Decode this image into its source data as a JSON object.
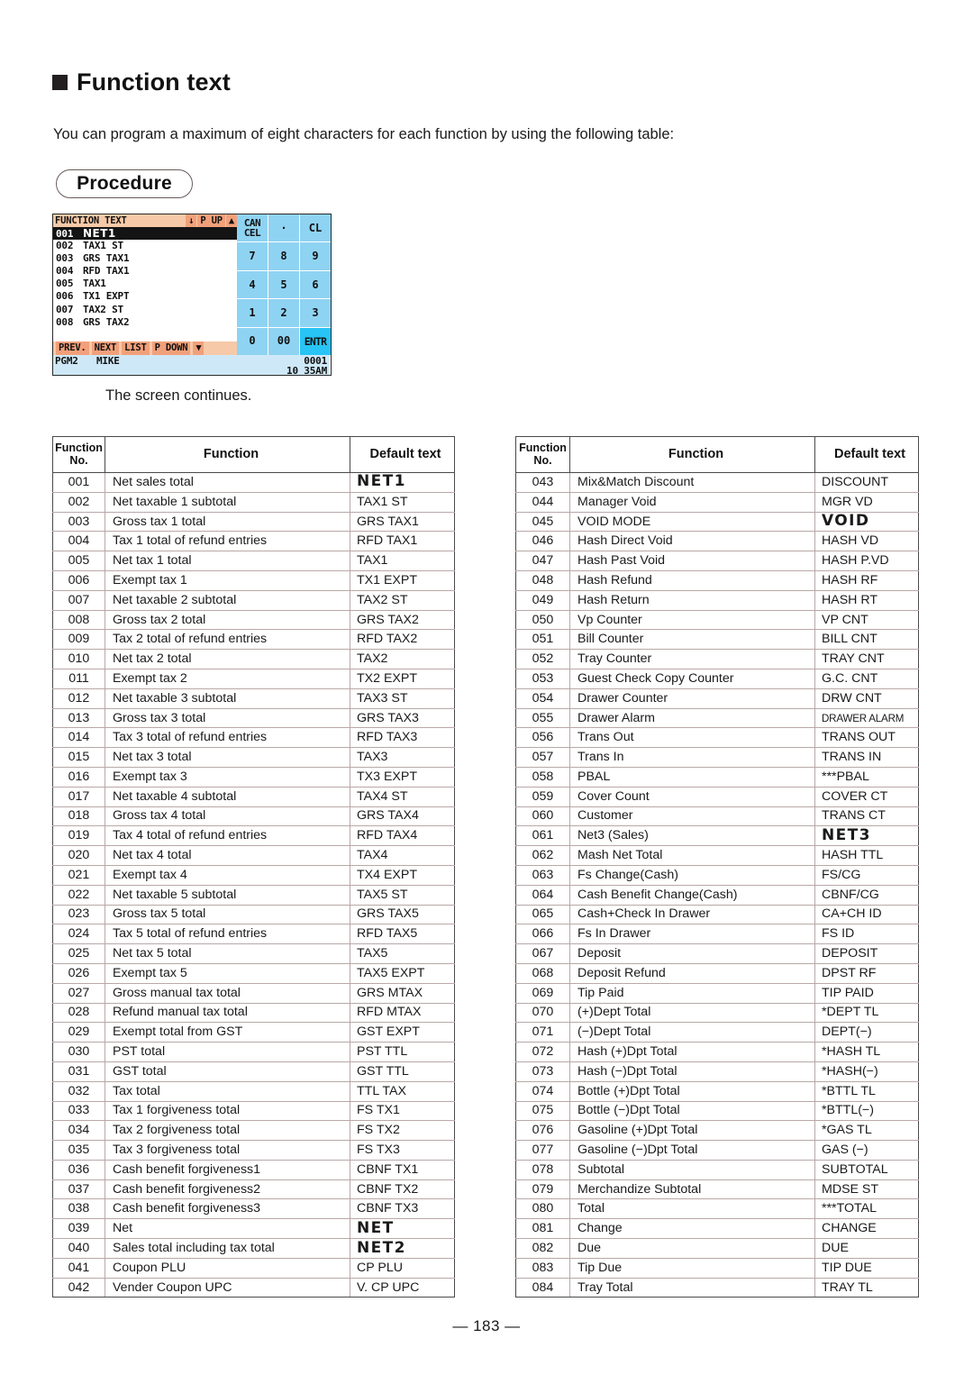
{
  "heading": {
    "title": "Function text"
  },
  "intro": {
    "text": "You can program a maximum of eight characters for each function by using the following table:"
  },
  "procedure": {
    "label": "Procedure"
  },
  "lcd": {
    "title": "FUNCTION TEXT",
    "title_buttons": [
      "↓",
      "P UP",
      "▲"
    ],
    "list": [
      {
        "no": "001",
        "text": "NET1",
        "selected": true
      },
      {
        "no": "002",
        "text": "TAX1 ST",
        "selected": false
      },
      {
        "no": "003",
        "text": "GRS TAX1",
        "selected": false
      },
      {
        "no": "004",
        "text": "RFD TAX1",
        "selected": false
      },
      {
        "no": "005",
        "text": "TAX1",
        "selected": false
      },
      {
        "no": "006",
        "text": "TX1 EXPT",
        "selected": false
      },
      {
        "no": "007",
        "text": "TAX2 ST",
        "selected": false
      },
      {
        "no": "008",
        "text": "GRS TAX2",
        "selected": false
      }
    ],
    "soft_buttons": [
      "PREV.",
      "NEXT",
      "LIST",
      "P DOWN",
      "▼"
    ],
    "keypad": [
      "CANCEL",
      "·",
      "CL",
      "7",
      "8",
      "9",
      "4",
      "5",
      "6",
      "1",
      "2",
      "3",
      "0",
      "00",
      "ENTR"
    ],
    "status": {
      "mode": "PGM2",
      "user": "MIKE",
      "counter": "0001",
      "clock": "10 35AM"
    }
  },
  "caption": {
    "screen_continues": "The screen continues."
  },
  "table_headers": {
    "no": "Function\nNo.",
    "no_line1": "Function",
    "no_line2": "No.",
    "function": "Function",
    "default_text": "Default text"
  },
  "left_table": [
    {
      "no": "001",
      "fn": "Net sales total",
      "txt": "NET1",
      "style": "lcd"
    },
    {
      "no": "002",
      "fn": "Net taxable 1 subtotal",
      "txt": "TAX1 ST",
      "style": ""
    },
    {
      "no": "003",
      "fn": "Gross tax 1 total",
      "txt": "GRS TAX1",
      "style": ""
    },
    {
      "no": "004",
      "fn": "Tax 1 total of refund entries",
      "txt": "RFD TAX1",
      "style": ""
    },
    {
      "no": "005",
      "fn": "Net tax 1 total",
      "txt": "TAX1",
      "style": ""
    },
    {
      "no": "006",
      "fn": "Exempt tax 1",
      "txt": "TX1 EXPT",
      "style": ""
    },
    {
      "no": "007",
      "fn": "Net taxable 2 subtotal",
      "txt": "TAX2 ST",
      "style": ""
    },
    {
      "no": "008",
      "fn": "Gross tax 2 total",
      "txt": "GRS TAX2",
      "style": ""
    },
    {
      "no": "009",
      "fn": "Tax 2 total of refund entries",
      "txt": "RFD TAX2",
      "style": ""
    },
    {
      "no": "010",
      "fn": "Net tax 2 total",
      "txt": "TAX2",
      "style": ""
    },
    {
      "no": "011",
      "fn": "Exempt tax 2",
      "txt": "TX2 EXPT",
      "style": ""
    },
    {
      "no": "012",
      "fn": "Net taxable 3 subtotal",
      "txt": "TAX3 ST",
      "style": ""
    },
    {
      "no": "013",
      "fn": "Gross tax 3 total",
      "txt": "GRS TAX3",
      "style": ""
    },
    {
      "no": "014",
      "fn": "Tax 3 total of refund entries",
      "txt": "RFD TAX3",
      "style": ""
    },
    {
      "no": "015",
      "fn": "Net tax 3 total",
      "txt": "TAX3",
      "style": ""
    },
    {
      "no": "016",
      "fn": "Exempt tax 3",
      "txt": "TX3 EXPT",
      "style": ""
    },
    {
      "no": "017",
      "fn": "Net taxable 4 subtotal",
      "txt": "TAX4 ST",
      "style": ""
    },
    {
      "no": "018",
      "fn": "Gross tax 4 total",
      "txt": "GRS TAX4",
      "style": ""
    },
    {
      "no": "019",
      "fn": "Tax 4 total of refund entries",
      "txt": "RFD TAX4",
      "style": ""
    },
    {
      "no": "020",
      "fn": "Net tax 4 total",
      "txt": "TAX4",
      "style": ""
    },
    {
      "no": "021",
      "fn": "Exempt tax 4",
      "txt": "TX4 EXPT",
      "style": ""
    },
    {
      "no": "022",
      "fn": "Net taxable 5 subtotal",
      "txt": "TAX5 ST",
      "style": ""
    },
    {
      "no": "023",
      "fn": "Gross tax 5 total",
      "txt": "GRS TAX5",
      "style": ""
    },
    {
      "no": "024",
      "fn": "Tax 5 total of refund entries",
      "txt": "RFD TAX5",
      "style": ""
    },
    {
      "no": "025",
      "fn": "Net tax 5 total",
      "txt": "TAX5",
      "style": ""
    },
    {
      "no": "026",
      "fn": "Exempt tax 5",
      "txt": "TAX5 EXPT",
      "style": ""
    },
    {
      "no": "027",
      "fn": "Gross manual tax total",
      "txt": "GRS MTAX",
      "style": ""
    },
    {
      "no": "028",
      "fn": "Refund manual tax total",
      "txt": "RFD MTAX",
      "style": ""
    },
    {
      "no": "029",
      "fn": "Exempt total from GST",
      "txt": "GST EXPT",
      "style": ""
    },
    {
      "no": "030",
      "fn": "PST total",
      "txt": "PST TTL",
      "style": ""
    },
    {
      "no": "031",
      "fn": "GST total",
      "txt": "GST TTL",
      "style": ""
    },
    {
      "no": "032",
      "fn": "Tax total",
      "txt": "TTL TAX",
      "style": ""
    },
    {
      "no": "033",
      "fn": "Tax 1 forgiveness total",
      "txt": "FS TX1",
      "style": ""
    },
    {
      "no": "034",
      "fn": "Tax 2 forgiveness total",
      "txt": "FS TX2",
      "style": ""
    },
    {
      "no": "035",
      "fn": "Tax 3 forgiveness total",
      "txt": "FS TX3",
      "style": ""
    },
    {
      "no": "036",
      "fn": "Cash benefit forgiveness1",
      "txt": "CBNF TX1",
      "style": ""
    },
    {
      "no": "037",
      "fn": "Cash benefit forgiveness2",
      "txt": "CBNF TX2",
      "style": ""
    },
    {
      "no": "038",
      "fn": "Cash benefit forgiveness3",
      "txt": "CBNF TX3",
      "style": ""
    },
    {
      "no": "039",
      "fn": "Net",
      "txt": "NET",
      "style": "lcd"
    },
    {
      "no": "040",
      "fn": "Sales total including tax total",
      "txt": "NET2",
      "style": "lcd"
    },
    {
      "no": "041",
      "fn": "Coupon PLU",
      "txt": "CP PLU",
      "style": ""
    },
    {
      "no": "042",
      "fn": "Vender Coupon UPC",
      "txt": "V. CP UPC",
      "style": ""
    }
  ],
  "right_table": [
    {
      "no": "043",
      "fn": "Mix&Match Discount",
      "txt": "DISCOUNT",
      "style": ""
    },
    {
      "no": "044",
      "fn": "Manager Void",
      "txt": "MGR VD",
      "style": ""
    },
    {
      "no": "045",
      "fn": "VOID MODE",
      "txt": "VOID",
      "style": "lcd"
    },
    {
      "no": "046",
      "fn": "Hash Direct Void",
      "txt": "HASH VD",
      "style": ""
    },
    {
      "no": "047",
      "fn": "Hash Past Void",
      "txt": "HASH P.VD",
      "style": ""
    },
    {
      "no": "048",
      "fn": "Hash Refund",
      "txt": "HASH RF",
      "style": ""
    },
    {
      "no": "049",
      "fn": "Hash Return",
      "txt": "HASH RT",
      "style": ""
    },
    {
      "no": "050",
      "fn": "Vp Counter",
      "txt": "VP CNT",
      "style": ""
    },
    {
      "no": "051",
      "fn": "Bill Counter",
      "txt": "BILL CNT",
      "style": ""
    },
    {
      "no": "052",
      "fn": "Tray Counter",
      "txt": "TRAY CNT",
      "style": ""
    },
    {
      "no": "053",
      "fn": "Guest Check Copy Counter",
      "txt": "G.C. CNT",
      "style": ""
    },
    {
      "no": "054",
      "fn": "Drawer Counter",
      "txt": "DRW CNT",
      "style": ""
    },
    {
      "no": "055",
      "fn": "Drawer Alarm",
      "txt": "DRAWER ALARM",
      "style": "tiny"
    },
    {
      "no": "056",
      "fn": "Trans Out",
      "txt": "TRANS OUT",
      "style": ""
    },
    {
      "no": "057",
      "fn": "Trans In",
      "txt": "TRANS IN",
      "style": ""
    },
    {
      "no": "058",
      "fn": "PBAL",
      "txt": "***PBAL",
      "style": ""
    },
    {
      "no": "059",
      "fn": "Cover Count",
      "txt": "COVER CT",
      "style": ""
    },
    {
      "no": "060",
      "fn": "Customer",
      "txt": "TRANS CT",
      "style": ""
    },
    {
      "no": "061",
      "fn": "Net3 (Sales)",
      "txt": "NET3",
      "style": "lcd"
    },
    {
      "no": "062",
      "fn": "Mash Net Total",
      "txt": "HASH TTL",
      "style": ""
    },
    {
      "no": "063",
      "fn": "Fs Change(Cash)",
      "txt": "FS/CG",
      "style": ""
    },
    {
      "no": "064",
      "fn": "Cash Benefit Change(Cash)",
      "txt": "CBNF/CG",
      "style": ""
    },
    {
      "no": "065",
      "fn": "Cash+Check In Drawer",
      "txt": "CA+CH ID",
      "style": ""
    },
    {
      "no": "066",
      "fn": "Fs In Drawer",
      "txt": "FS ID",
      "style": ""
    },
    {
      "no": "067",
      "fn": "Deposit",
      "txt": "DEPOSIT",
      "style": ""
    },
    {
      "no": "068",
      "fn": "Deposit Refund",
      "txt": "DPST RF",
      "style": ""
    },
    {
      "no": "069",
      "fn": "Tip Paid",
      "txt": "TIP PAID",
      "style": ""
    },
    {
      "no": "070",
      "fn": "(+)Dept Total",
      "txt": "*DEPT TL",
      "style": ""
    },
    {
      "no": "071",
      "fn": "(−)Dept Total",
      "txt": "DEPT(−)",
      "style": ""
    },
    {
      "no": "072",
      "fn": "Hash (+)Dpt Total",
      "txt": "*HASH TL",
      "style": ""
    },
    {
      "no": "073",
      "fn": "Hash (−)Dpt Total",
      "txt": "*HASH(−)",
      "style": ""
    },
    {
      "no": "074",
      "fn": "Bottle (+)Dpt Total",
      "txt": "*BTTL TL",
      "style": ""
    },
    {
      "no": "075",
      "fn": "Bottle (−)Dpt Total",
      "txt": "*BTTL(−)",
      "style": ""
    },
    {
      "no": "076",
      "fn": "Gasoline (+)Dpt Total",
      "txt": "*GAS TL",
      "style": ""
    },
    {
      "no": "077",
      "fn": "Gasoline (−)Dpt Total",
      "txt": "GAS (−)",
      "style": ""
    },
    {
      "no": "078",
      "fn": "Subtotal",
      "txt": "SUBTOTAL",
      "style": ""
    },
    {
      "no": "079",
      "fn": "Merchandize Subtotal",
      "txt": "MDSE ST",
      "style": ""
    },
    {
      "no": "080",
      "fn": "Total",
      "txt": "***TOTAL",
      "style": ""
    },
    {
      "no": "081",
      "fn": "Change",
      "txt": "CHANGE",
      "style": ""
    },
    {
      "no": "082",
      "fn": "Due",
      "txt": "DUE",
      "style": ""
    },
    {
      "no": "083",
      "fn": "Tip Due",
      "txt": "TIP DUE",
      "style": ""
    },
    {
      "no": "084",
      "fn": "Tray Total",
      "txt": "TRAY TL",
      "style": ""
    }
  ],
  "footer": {
    "page": "— 183 —"
  }
}
